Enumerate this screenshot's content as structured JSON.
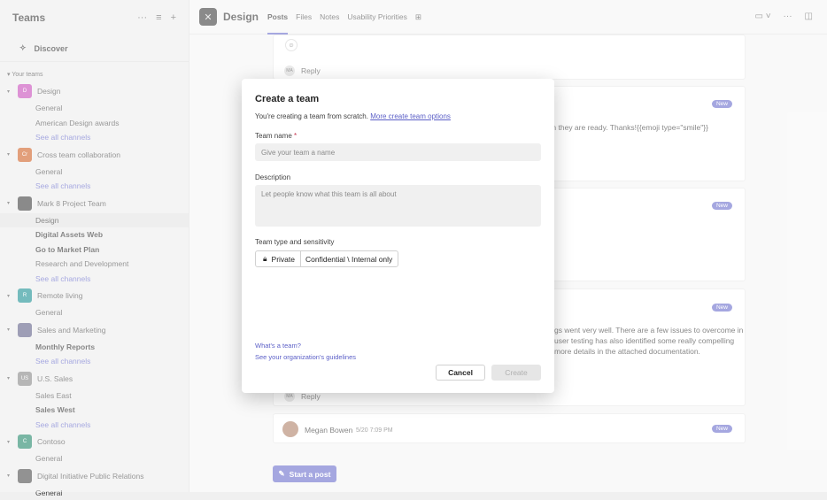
{
  "sidebar": {
    "title": "Teams",
    "discover": "Discover",
    "section": "Your teams",
    "teams": [
      {
        "initials": "D",
        "name": "Design",
        "color": "#c239b3",
        "channels": [
          {
            "label": "General",
            "style": ""
          },
          {
            "label": "American Design awards",
            "style": ""
          },
          {
            "label": "See all channels",
            "style": "link"
          }
        ]
      },
      {
        "initials": "Cr",
        "name": "Cross team collaboration",
        "color": "#ca5010",
        "channels": [
          {
            "label": "General",
            "style": ""
          },
          {
            "label": "See all channels",
            "style": "link"
          }
        ]
      },
      {
        "initials": "",
        "name": "Mark 8 Project Team",
        "color": "#2b2b2b",
        "channels": [
          {
            "label": "Design",
            "style": "selected"
          },
          {
            "label": "Digital Assets Web",
            "style": "bold"
          },
          {
            "label": "Go to Market Plan",
            "style": "bold"
          },
          {
            "label": "Research and Development",
            "style": ""
          },
          {
            "label": "See all channels",
            "style": "link"
          }
        ]
      },
      {
        "initials": "R",
        "name": "Remote living",
        "color": "#038387",
        "channels": [
          {
            "label": "General",
            "style": ""
          }
        ]
      },
      {
        "initials": "",
        "name": "Sales and Marketing",
        "color": "#4f4f7a",
        "channels": [
          {
            "label": "Monthly Reports",
            "style": "bold"
          },
          {
            "label": "See all channels",
            "style": "link"
          }
        ]
      },
      {
        "initials": "US",
        "name": "U.S. Sales",
        "color": "#7a7a7a",
        "channels": [
          {
            "label": "Sales East",
            "style": ""
          },
          {
            "label": "Sales West",
            "style": "bold"
          },
          {
            "label": "See all channels",
            "style": "link"
          }
        ]
      },
      {
        "initials": "C",
        "name": "Contoso",
        "color": "#0b7a5a",
        "channels": [
          {
            "label": "General",
            "style": ""
          }
        ]
      },
      {
        "initials": "",
        "name": "Digital Initiative Public Relations",
        "color": "#3a3a3a",
        "channels": [
          {
            "label": "General",
            "style": ""
          }
        ]
      }
    ]
  },
  "header": {
    "channel_title": "Design",
    "tabs": [
      "Posts",
      "Files",
      "Notes",
      "Usability Priorities"
    ]
  },
  "posts": {
    "reply_label": "Reply",
    "new_label": "New",
    "post2_text": "ed when they are ready. Thanks!{{emoji type=\"smile\"}}",
    "post4_lines": [
      "gs went very well. There are a few issues to overcome in",
      "user testing has also identified some really compelling",
      "more details in the attached documentation."
    ],
    "last_author": "Megan Bowen",
    "last_time": "5/20 7:09 PM",
    "start_post": "Start a post"
  },
  "dialog": {
    "title": "Create a team",
    "subtitle": "You're creating a team from scratch.",
    "subtitle_link": "More create team options",
    "name_label": "Team name",
    "name_required": "*",
    "name_placeholder": "Give your team a name",
    "desc_label": "Description",
    "desc_placeholder": "Let people know what this team is all about",
    "type_label": "Team type and sensitivity",
    "type_private": "Private",
    "type_sensitivity": "Confidential \\ Internal only",
    "link_whats": "What's a team?",
    "link_guidelines": "See your organization's guidelines",
    "cancel": "Cancel",
    "create": "Create"
  }
}
